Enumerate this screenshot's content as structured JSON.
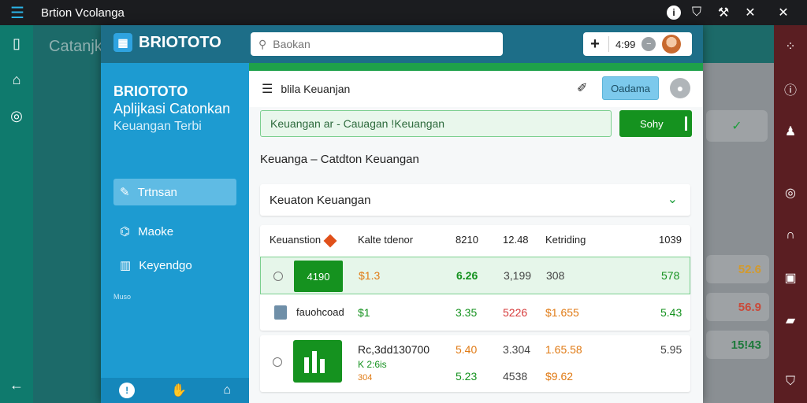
{
  "os": {
    "title": "Brtion Vcolanga",
    "right_icons": [
      "info-icon",
      "shield-icon",
      "tool-icon",
      "cross-icon",
      "close-icon"
    ]
  },
  "background": {
    "title": "Catanjk",
    "right_values": [
      "52.6",
      "56.9",
      "15!43"
    ]
  },
  "header": {
    "logo": "BRIOTOTO",
    "search_placeholder": "Baokan",
    "counter": "4:99"
  },
  "sidebar": {
    "brand": "BRIOTOTO",
    "sub1": "Aplijkasi Catonkan",
    "sub2": "Keuangan Terbi",
    "items": [
      {
        "label": "Trtnsan",
        "active": true
      },
      {
        "label": "Maoke",
        "active": false
      },
      {
        "label": "Keyendgo",
        "active": false
      }
    ],
    "tiny": "Muso"
  },
  "toolbar": {
    "title": "blila Keuanjan",
    "button": "Oadama"
  },
  "input_row": {
    "text": "Keuangan ar - Cauagan !Keuangan",
    "save": "Sohy"
  },
  "section_title": "Keuanga  –  Catdton Keuangan",
  "accordion": {
    "label": "Keuaton Keuangan"
  },
  "table": {
    "headers": [
      "Keuanstion",
      "Kalte tdenor",
      "8210",
      "12.48",
      "Ketriding",
      "1039"
    ],
    "rows": [
      {
        "tag": "4190",
        "c1": "$1.3",
        "c2": "6.26",
        "c3": "3,199",
        "c4": "308",
        "c5": "578"
      },
      {
        "tag": "fauohcoad",
        "c1": "$1",
        "c2": "3.35",
        "c3": "5226",
        "c4": "$1.655",
        "c5": "5.43"
      }
    ]
  },
  "card2": {
    "title": "Rc,3dd130700",
    "sub": "K 2:6is",
    "sub2": "304",
    "r1": [
      "5.40",
      "3.304",
      "1.65.58",
      "5.95"
    ],
    "r2": [
      "5.23",
      "4538",
      "$9.62"
    ]
  }
}
